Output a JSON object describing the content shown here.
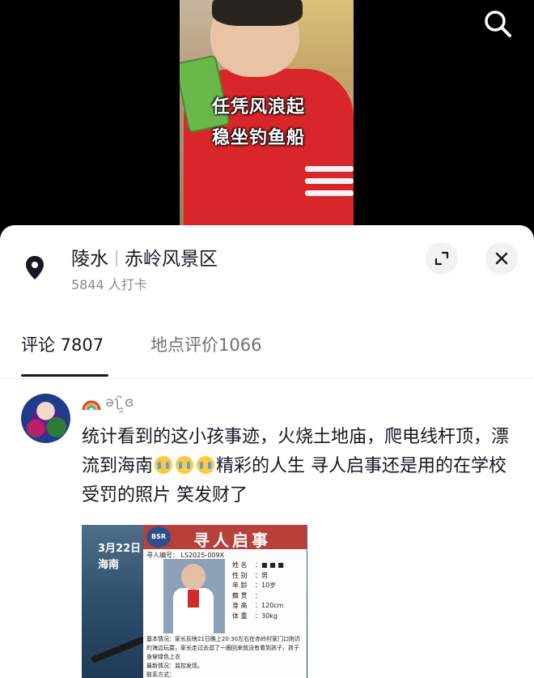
{
  "video": {
    "caption_line1": "任凭风浪起",
    "caption_line2": "稳坐钓鱼船"
  },
  "location": {
    "name": "陵水",
    "area": "赤岭风景区",
    "checkins": "5844 人打卡"
  },
  "tabs": [
    {
      "label": "评论 7807",
      "active": true
    },
    {
      "label": "地点评价1066",
      "active": false
    }
  ],
  "comment": {
    "username": "əʅ́ ̯̯̀ɞ",
    "text_part1": "统计看到的这小孩事迹，火烧土地庙，爬电线杆顶，漂流到海南",
    "text_part2": "精彩的人生 寻人启事还是用的在学校受罚的照片  笑发财了",
    "emoji": "crying-laughing-emoji"
  },
  "attachment": {
    "date": "3月22日",
    "place": "海南",
    "poster_title": "寻人启事",
    "poster_logo": "BSR",
    "poster_id": "寻人编号： LS2025-009X",
    "fields": [
      {
        "k": "姓 名",
        "v": "■ ■ ■"
      },
      {
        "k": "性 别",
        "v": "男"
      },
      {
        "k": "年 龄",
        "v": "10岁"
      },
      {
        "k": "籍 贯",
        "v": ""
      },
      {
        "k": "身 高",
        "v": "120cm"
      },
      {
        "k": "体 重",
        "v": "30kg"
      }
    ],
    "details_1": "基本情况：家长反映21日晚上20:30左右在赤岭村家门口附近的海边玩耍，家长走过去逛了一圈回来就没有看到孩子，孩子身穿绿色上衣",
    "details_2": "最新情况：监控发现。",
    "details_3": "联系方式："
  },
  "colors": {
    "text_primary": "#161823",
    "text_secondary": "#8a8b91",
    "poster_red": "#b8403a"
  }
}
